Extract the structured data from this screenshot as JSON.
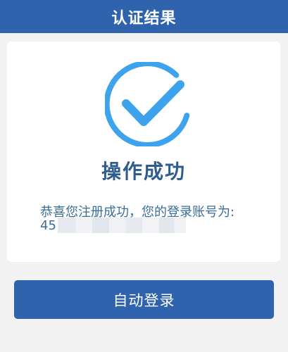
{
  "header": {
    "title": "认证结果"
  },
  "result": {
    "icon": "check-circle-icon",
    "status_title": "操作成功",
    "message": "恭喜您注册成功，您的登录账号为:",
    "account_visible": "45"
  },
  "actions": {
    "auto_login_label": "自动登录"
  },
  "colors": {
    "primary": "#2f63ad",
    "icon_accent": "#3ea3ed",
    "text_accent": "#3a6d9a",
    "background": "#f2f2f2"
  }
}
